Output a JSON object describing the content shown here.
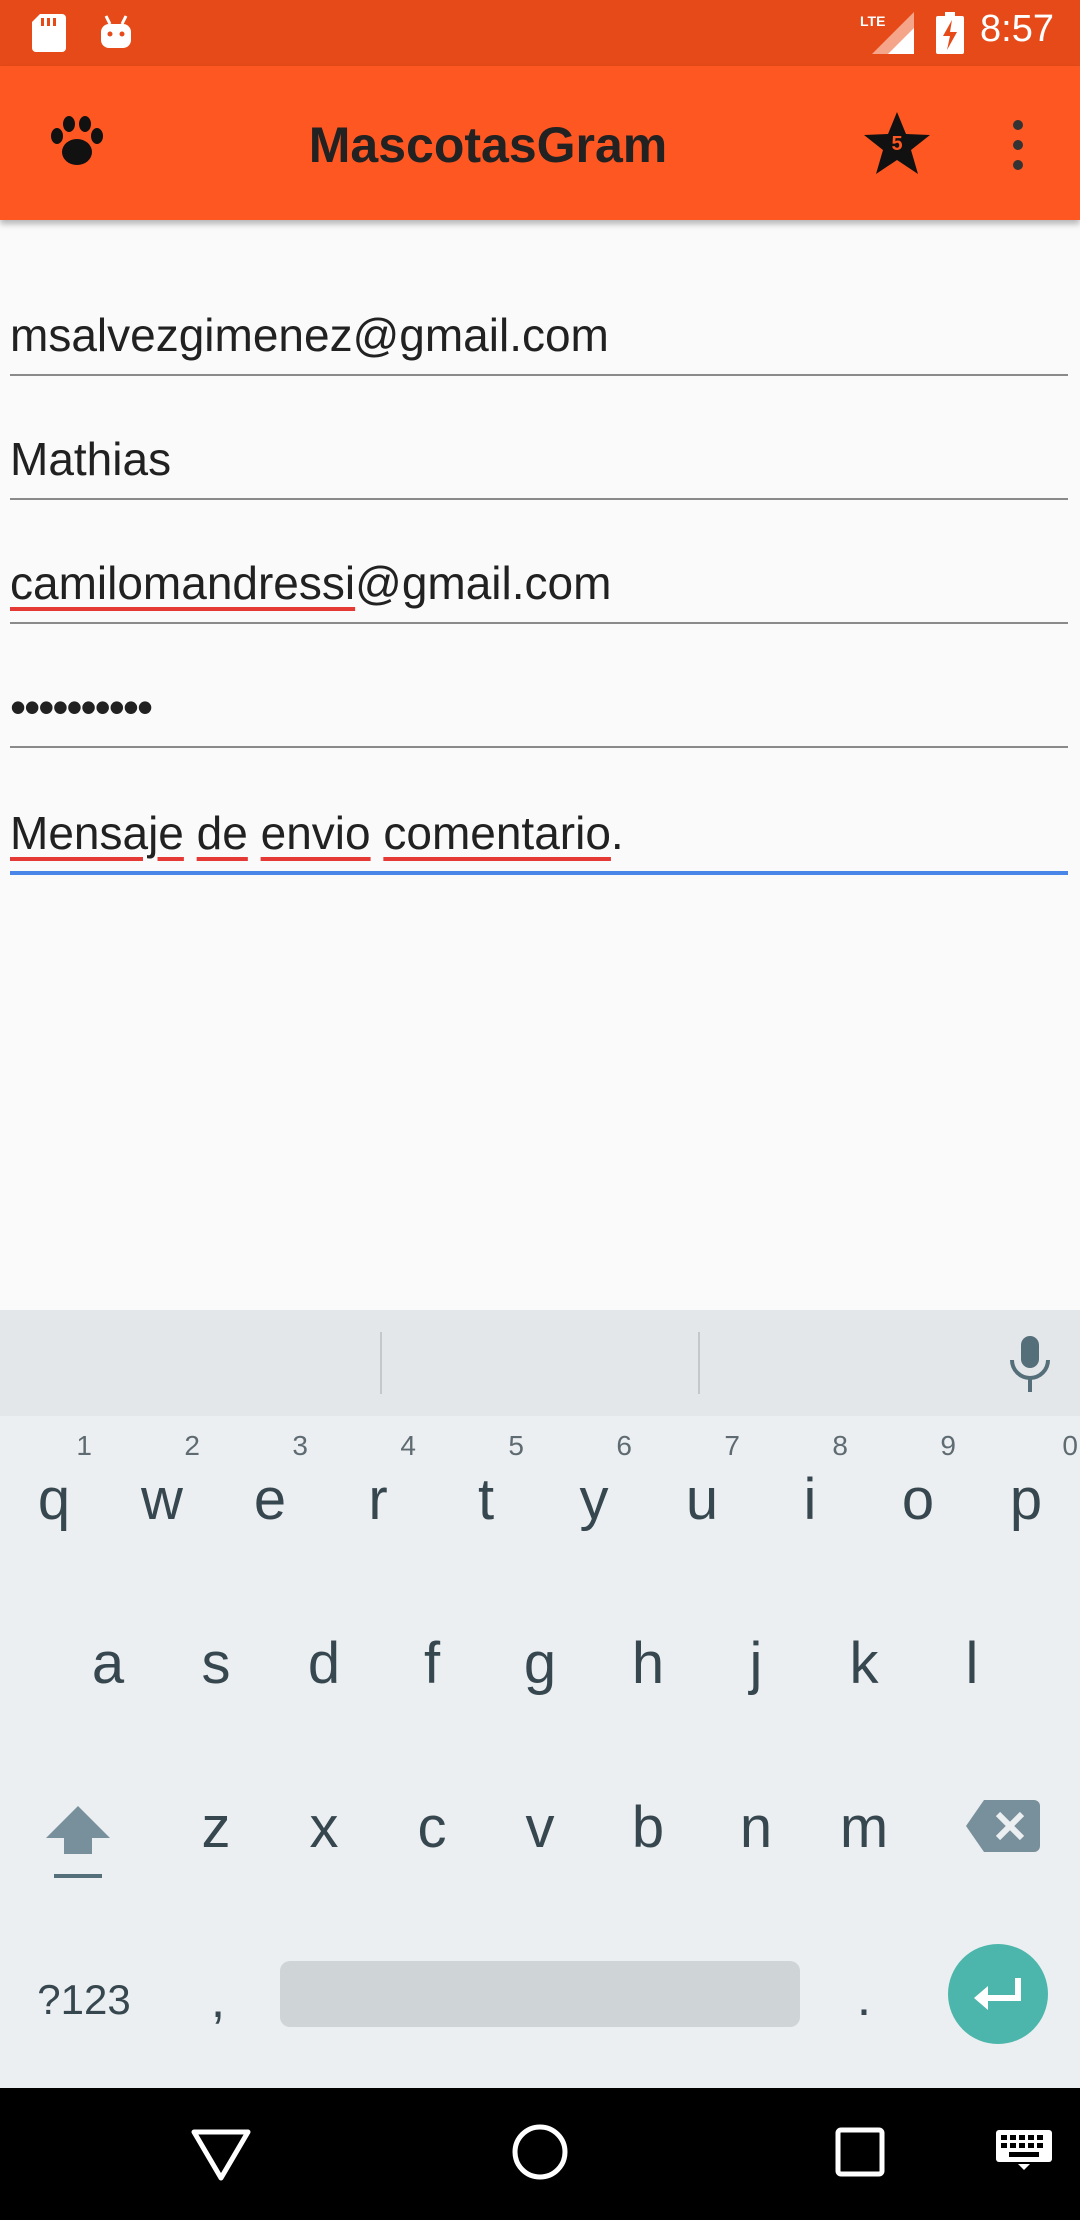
{
  "status_bar": {
    "time": "8:57",
    "network": "LTE",
    "icons": [
      "sd-card-icon",
      "android-icon",
      "lte-signal-icon",
      "battery-charging-icon"
    ]
  },
  "app_bar": {
    "title": "MascotasGram",
    "left_icon": "paw-icon",
    "favorites_badge": "5",
    "right_icons": [
      "star-icon",
      "more-vert-icon"
    ]
  },
  "form": {
    "fields": [
      {
        "name": "sender-email",
        "value": "msalvezgimenez@gmail.com"
      },
      {
        "name": "sender-name",
        "value": "Mathias"
      },
      {
        "name": "recipient-email",
        "value_underlined": "camilomandressi",
        "value_rest": "@gmail.com"
      },
      {
        "name": "password",
        "value": "••••••••••"
      },
      {
        "name": "message",
        "words": [
          "Mensaje",
          "de",
          "envio",
          "comentario"
        ],
        "ending": "."
      }
    ]
  },
  "keyboard": {
    "row1": [
      {
        "key": "q",
        "hint": "1"
      },
      {
        "key": "w",
        "hint": "2"
      },
      {
        "key": "e",
        "hint": "3"
      },
      {
        "key": "r",
        "hint": "4"
      },
      {
        "key": "t",
        "hint": "5"
      },
      {
        "key": "y",
        "hint": "6"
      },
      {
        "key": "u",
        "hint": "7"
      },
      {
        "key": "i",
        "hint": "8"
      },
      {
        "key": "o",
        "hint": "9"
      },
      {
        "key": "p",
        "hint": "0"
      }
    ],
    "row2": [
      "a",
      "s",
      "d",
      "f",
      "g",
      "h",
      "j",
      "k",
      "l"
    ],
    "row3": [
      "z",
      "x",
      "c",
      "v",
      "b",
      "n",
      "m"
    ],
    "symbols_label": "?123",
    "comma_label": ",",
    "period_label": ".",
    "enter_color": "#4db6ac"
  },
  "nav_bar": {
    "icons": [
      "back-icon",
      "home-icon",
      "recents-icon",
      "keyboard-icon"
    ]
  },
  "colors": {
    "status_bar": "#e64a19",
    "app_bar": "#ff5722",
    "focus_underline": "#4a86e8",
    "spell_underline": "#e53935"
  }
}
